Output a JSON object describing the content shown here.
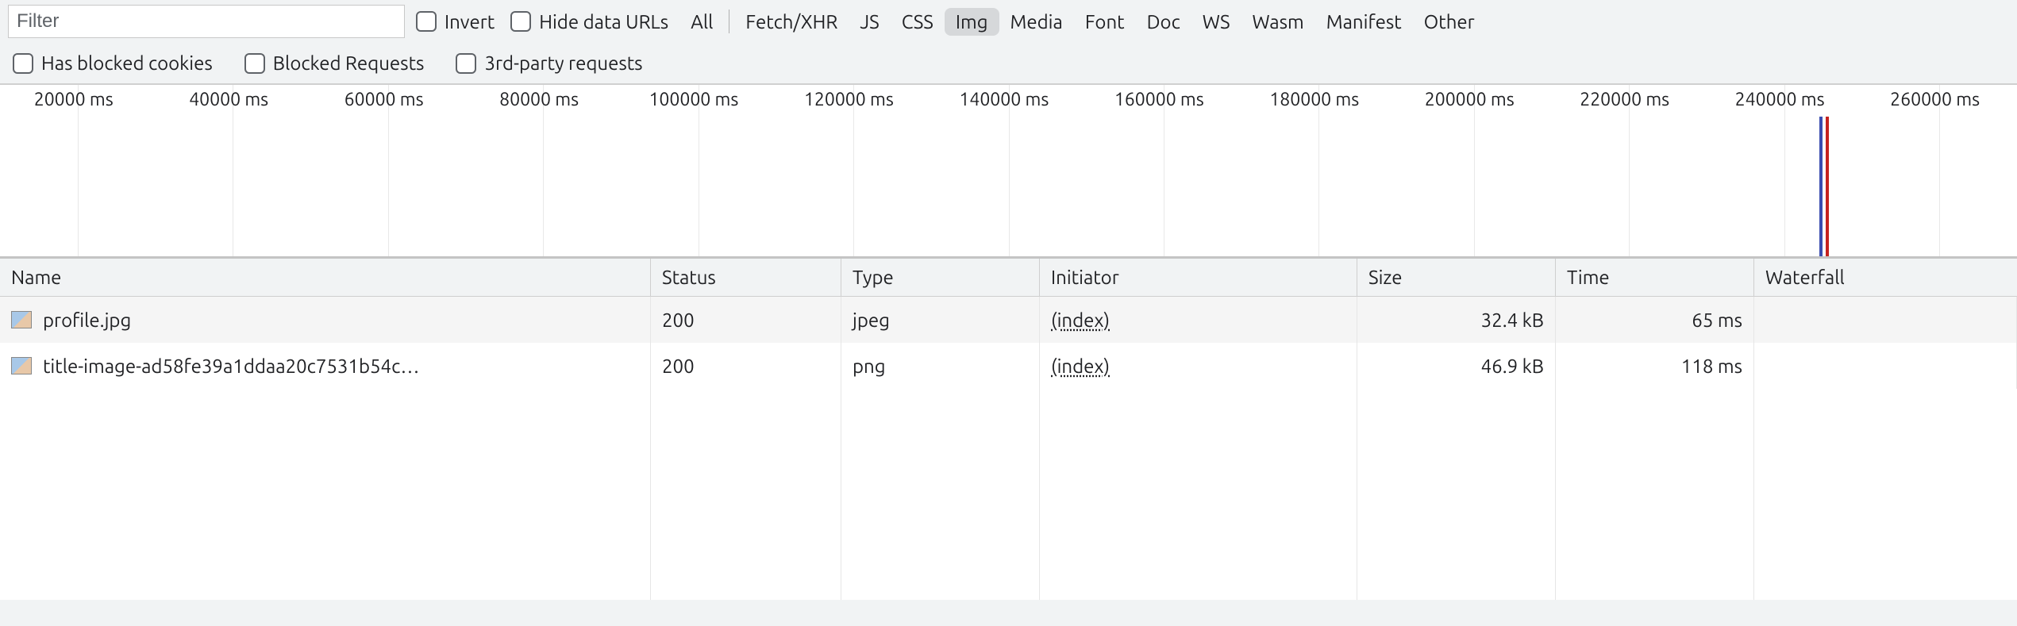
{
  "toolbar": {
    "filter_placeholder": "Filter",
    "invert_label": "Invert",
    "hide_data_urls_label": "Hide data URLs",
    "type_filters": [
      "All",
      "Fetch/XHR",
      "JS",
      "CSS",
      "Img",
      "Media",
      "Font",
      "Doc",
      "WS",
      "Wasm",
      "Manifest",
      "Other"
    ],
    "active_type_filter": "Img",
    "has_blocked_cookies_label": "Has blocked cookies",
    "blocked_requests_label": "Blocked Requests",
    "third_party_label": "3rd-party requests"
  },
  "timeline": {
    "ticks": [
      "20000 ms",
      "40000 ms",
      "60000 ms",
      "80000 ms",
      "100000 ms",
      "120000 ms",
      "140000 ms",
      "160000 ms",
      "180000 ms",
      "200000 ms",
      "220000 ms",
      "240000 ms",
      "260000 ms"
    ],
    "markers": [
      {
        "position_pct": 90.2,
        "color": "#3b4db0"
      },
      {
        "position_pct": 90.5,
        "color": "#c5221f"
      }
    ]
  },
  "table": {
    "headers": {
      "name": "Name",
      "status": "Status",
      "type": "Type",
      "initiator": "Initiator",
      "size": "Size",
      "time": "Time",
      "waterfall": "Waterfall"
    },
    "rows": [
      {
        "name": "profile.jpg",
        "status": "200",
        "type": "jpeg",
        "initiator": "(index)",
        "size": "32.4 kB",
        "time": "65 ms"
      },
      {
        "name": "title-image-ad58fe39a1ddaa20c7531b54c…",
        "status": "200",
        "type": "png",
        "initiator": "(index)",
        "size": "46.9 kB",
        "time": "118 ms"
      }
    ]
  }
}
